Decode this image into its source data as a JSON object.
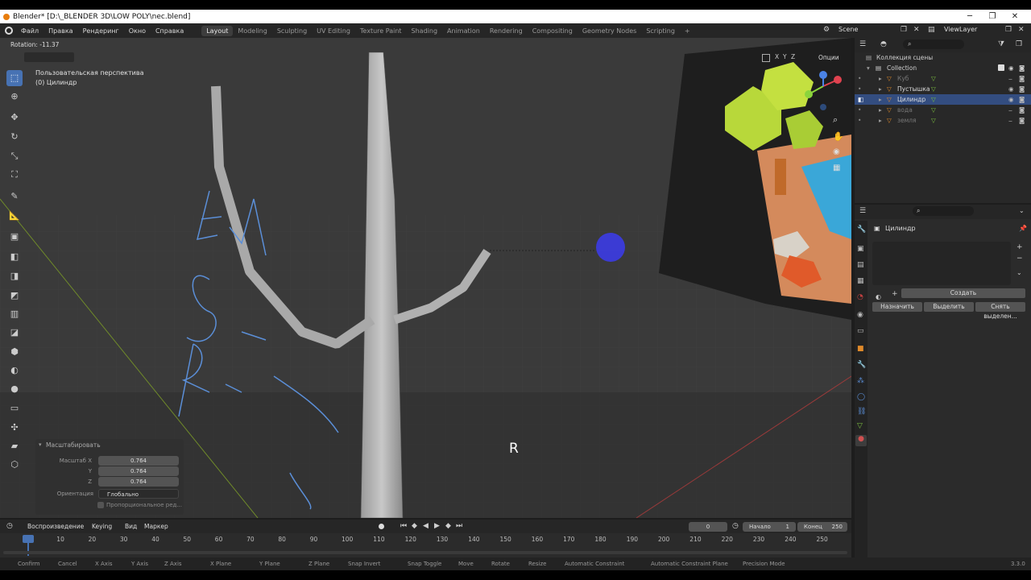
{
  "window": {
    "title": "Blender* [D:\\_BLENDER 3D\\LOW POLY\\nec.blend]",
    "controls": [
      "─",
      "❐",
      "✕"
    ]
  },
  "menu": [
    "Файл",
    "Правка",
    "Рендеринг",
    "Окно",
    "Справка"
  ],
  "workspaces": [
    "Layout",
    "Modeling",
    "Sculpting",
    "UV Editing",
    "Texture Paint",
    "Shading",
    "Animation",
    "Rendering",
    "Compositing",
    "Geometry Nodes",
    "Scripting",
    "+"
  ],
  "scene": {
    "name": "Scene",
    "viewlayer": "ViewLayer"
  },
  "viewport": {
    "header_text": "Rotation: -11.37",
    "view_name": "Пользовательская перспектива",
    "object_name": "(0) Цилиндр",
    "options_label": "Опции",
    "axes": [
      "X",
      "Y",
      "Z"
    ],
    "key_hint": "R",
    "handwriting": [
      "E-M",
      "S-масштаб",
      "R-вращение"
    ]
  },
  "operator_panel": {
    "title": "Масштабировать",
    "scale_label": "Масштаб X",
    "y_label": "Y",
    "z_label": "Z",
    "x": "0.764",
    "y": "0.764",
    "z": "0.764",
    "orientation_label": "Ориентация",
    "orientation_value": "Глобально",
    "proportional": "Пропорциональное ред..."
  },
  "outliner": {
    "root": "Коллекция сцены",
    "collection": "Collection",
    "items": [
      {
        "name": "Куб",
        "selected": false,
        "dim": true
      },
      {
        "name": "Пустышка",
        "selected": false,
        "dim": false
      },
      {
        "name": "Цилиндр",
        "selected": true,
        "dim": false
      },
      {
        "name": "вода",
        "selected": false,
        "dim": true
      },
      {
        "name": "земля",
        "selected": false,
        "dim": true
      }
    ]
  },
  "properties": {
    "object_name": "Цилиндр",
    "create": "Создать",
    "assign": "Назначить",
    "select": "Выделить",
    "deselect": "Снять выделен..."
  },
  "timeline": {
    "playback": "Воспроизведение",
    "keying": "Keying",
    "view": "Вид",
    "marker": "Маркер",
    "current_frame": "0",
    "start_label": "Начало",
    "start": "1",
    "end_label": "Конец",
    "end": "250",
    "ticks": [
      "0",
      "10",
      "20",
      "30",
      "40",
      "50",
      "60",
      "70",
      "80",
      "90",
      "100",
      "110",
      "120",
      "130",
      "140",
      "150",
      "160",
      "170",
      "180",
      "190",
      "200",
      "210",
      "220",
      "230",
      "240",
      "250"
    ]
  },
  "statusbar": [
    "Confirm",
    "Cancel",
    "X Axis",
    "Y Axis",
    "Z Axis",
    "X Plane",
    "Y Plane",
    "Z Plane",
    "Snap Invert",
    "Snap Toggle",
    "Move",
    "Rotate",
    "Resize",
    "Automatic Constraint",
    "Automatic Constraint Plane",
    "Precision Mode"
  ],
  "version": "3.3.0",
  "colors": {
    "accent": "#4772b3",
    "gizmo_x": "#e0424f",
    "gizmo_y": "#8bd43c",
    "gizmo_z": "#4b83e6",
    "pen": "#5b8fd8"
  }
}
